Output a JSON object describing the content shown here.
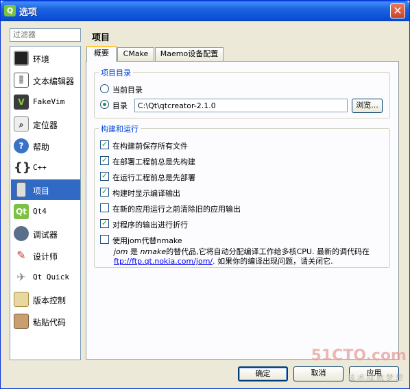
{
  "window": {
    "title": "选项",
    "icon": "qt-icon",
    "close_label": "✕"
  },
  "filter": {
    "placeholder": "过滤器"
  },
  "sidebar": {
    "items": [
      {
        "label": "环境",
        "icon": "monitor-icon"
      },
      {
        "label": "文本编辑器",
        "icon": "text-editor-icon"
      },
      {
        "label": "FakeVim",
        "icon": "fakevim-icon",
        "mono": true
      },
      {
        "label": "定位器",
        "icon": "locator-icon"
      },
      {
        "label": "帮助",
        "icon": "help-icon"
      },
      {
        "label": "C++",
        "icon": "cpp-icon"
      },
      {
        "label": "项目",
        "icon": "project-icon",
        "selected": true
      },
      {
        "label": "Qt4",
        "icon": "qt4-icon",
        "mono": true
      },
      {
        "label": "调试器",
        "icon": "debugger-icon"
      },
      {
        "label": "设计师",
        "icon": "designer-icon"
      },
      {
        "label": "Qt Quick",
        "icon": "qt-quick-icon",
        "mono": true
      },
      {
        "label": "版本控制",
        "icon": "version-control-icon"
      },
      {
        "label": "粘贴代码",
        "icon": "code-paste-icon"
      }
    ]
  },
  "main": {
    "title": "项目",
    "tabs": [
      {
        "label": "概要",
        "active": true
      },
      {
        "label": "CMake"
      },
      {
        "label": "Maemo设备配置"
      }
    ],
    "project_dir": {
      "title": "项目目录",
      "current_dir_label": "当前目录",
      "dir_label": "目录",
      "dir_value": "C:\\Qt\\qtcreator-2.1.0",
      "browse_label": "浏览...",
      "selected": "dir"
    },
    "build_run": {
      "title": "构建和运行",
      "options": [
        {
          "label": "在构建前保存所有文件",
          "checked": true
        },
        {
          "label": "在部署工程前总是先构建",
          "checked": true
        },
        {
          "label": "在运行工程前总是先部署",
          "checked": true
        },
        {
          "label": "构建时显示编译输出",
          "checked": true
        },
        {
          "label": "在新的应用运行之前清除旧的应用输出",
          "checked": false
        },
        {
          "label": "对程序的输出进行折行",
          "checked": true
        },
        {
          "label": "使用jom代替nmake",
          "checked": false
        }
      ],
      "jom_desc": {
        "jom": "jom",
        "part1": " 是 ",
        "nmake": "nmake",
        "part2": "的替代品,它将自动分配编译工作给多核CPU. 最新的调代码在",
        "link": "ftp://ftp.qt.nokia.com/jom/",
        "part3": ". 如果你的编译出现问题，请关闭它."
      }
    }
  },
  "footer": {
    "ok_label": "确定",
    "cancel_label": "取消",
    "apply_label": "应用"
  },
  "watermark": {
    "brand": "51CTO.com",
    "slogan": "技术成就梦想"
  },
  "colors": {
    "titlebar": "#0a4fd6",
    "selection": "#316ac5",
    "group_title": "#0046d5",
    "check": "#21a121"
  }
}
